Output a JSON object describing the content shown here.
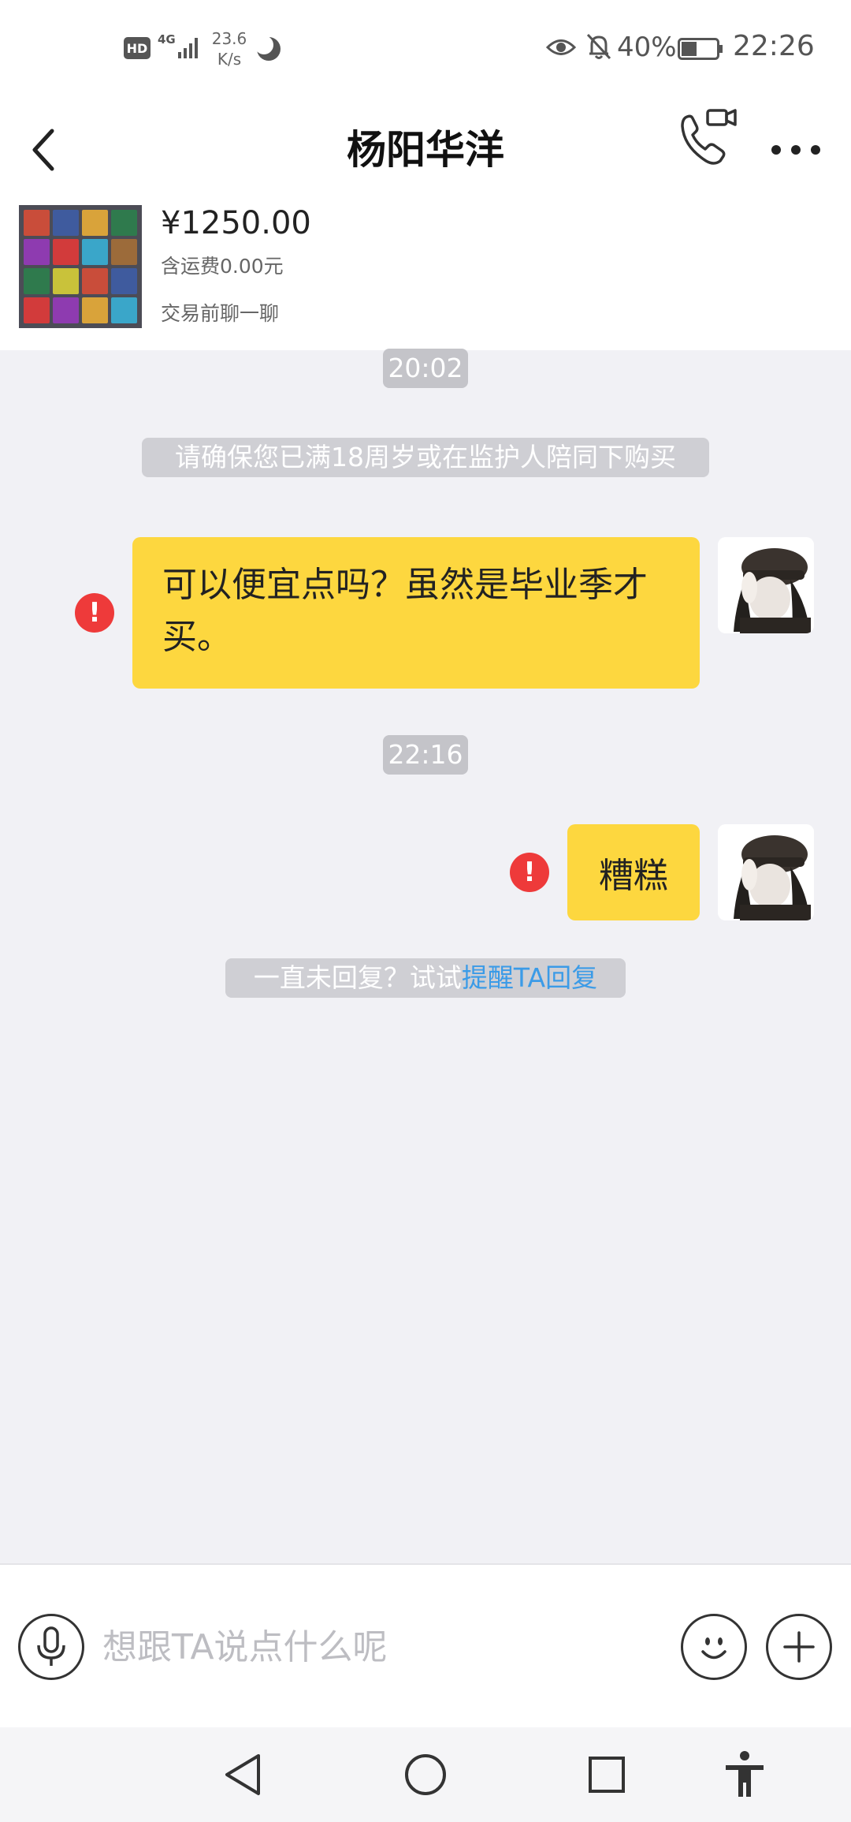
{
  "status_bar": {
    "hd": "HD",
    "network": "4G",
    "speed_value": "23.6",
    "speed_unit": "K/s",
    "battery_percent": "40%",
    "time": "22:26"
  },
  "header": {
    "title": "杨阳华洋"
  },
  "product": {
    "price": "¥1250.00",
    "shipping": "含运费0.00元",
    "chat_before_trade": "交易前聊一聊"
  },
  "chat": {
    "time_1": "20:02",
    "age_notice": "请确保您已满18周岁或在监护人陪同下购买",
    "message_1": "可以便宜点吗？虽然是毕业季才买。",
    "time_2": "22:16",
    "message_2": "糟糕",
    "failed_icon": "!",
    "reply_hint_prefix": "一直未回复？试试",
    "reply_hint_link": "提醒TA回复"
  },
  "input_bar": {
    "placeholder": "想跟TA说点什么呢"
  },
  "icons": {
    "back": "chevron-left-icon",
    "call": "phone-video-icon",
    "more": "more-dots-icon",
    "mic": "microphone-icon",
    "emoji": "smiley-icon",
    "plus": "plus-icon",
    "error": "exclamation-icon"
  },
  "colors": {
    "bubble": "#fdd73f",
    "background": "#f1f1f5",
    "error": "#ee3a3a",
    "link": "#3b9be7"
  }
}
